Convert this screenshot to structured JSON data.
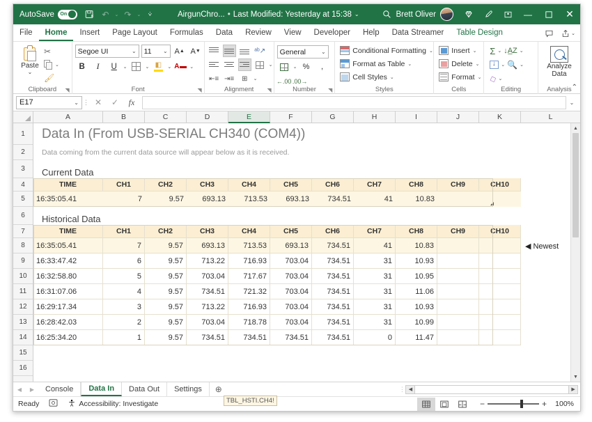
{
  "titlebar": {
    "autosave_label": "AutoSave",
    "autosave_state": "On",
    "doc_name": "AirgunChro...",
    "doc_separator": "•",
    "modified_text": "Last Modified: Yesterday at 15:38",
    "user_name": "Brett Oliver",
    "search_icon": "search-icon",
    "save_icon": "save-icon",
    "undo_icon": "undo-icon",
    "redo_icon": "redo-icon",
    "qat_more_icon": "customize-quick-access-toolbar-icon",
    "diamond_icon": "microsoft-rewards-icon",
    "pen_icon": "ink-pen-icon",
    "ribbon_display_icon": "ribbon-display-options-icon",
    "minimize_label": "—",
    "maximize_label": "▢",
    "close_label": "✕"
  },
  "ribbon_tabs": {
    "items": [
      {
        "label": "File",
        "state": "normal"
      },
      {
        "label": "Home",
        "state": "active"
      },
      {
        "label": "Insert",
        "state": "normal"
      },
      {
        "label": "Page Layout",
        "state": "normal"
      },
      {
        "label": "Formulas",
        "state": "normal"
      },
      {
        "label": "Data",
        "state": "normal"
      },
      {
        "label": "Review",
        "state": "normal"
      },
      {
        "label": "View",
        "state": "normal"
      },
      {
        "label": "Developer",
        "state": "normal"
      },
      {
        "label": "Help",
        "state": "normal"
      },
      {
        "label": "Data Streamer",
        "state": "normal"
      },
      {
        "label": "Table Design",
        "state": "contextual"
      }
    ],
    "comments_icon": "comments-icon",
    "share_icon": "share-icon",
    "share_caret": "⌄"
  },
  "ribbon": {
    "clipboard": {
      "group_label": "Clipboard",
      "paste_label": "Paste",
      "paste_caret": "⌄",
      "cut_label": "Cut",
      "copy_label": "Copy",
      "format_painter_label": "Format Painter",
      "dialog_launcher": "◥"
    },
    "font": {
      "group_label": "Font",
      "font_name": "Segoe UI",
      "font_size": "11",
      "grow_font": "A",
      "shrink_font": "A",
      "bold": "B",
      "italic": "I",
      "underline": "U",
      "borders_label": "Borders",
      "fill_color_label": "Fill Color",
      "font_color_label": "Font Color",
      "dialog_launcher": "◥"
    },
    "alignment": {
      "group_label": "Alignment",
      "top_align": "Top Align",
      "middle_align": "Middle Align",
      "bottom_align": "Bottom Align",
      "orientation": "Orientation",
      "align_left": "Align Left",
      "center": "Center",
      "align_right": "Align Right",
      "wrap_text": "Wrap Text",
      "decrease_indent": "Decrease Indent",
      "increase_indent": "Increase Indent",
      "merge_center": "Merge & Center",
      "dialog_launcher": "◥"
    },
    "number": {
      "group_label": "Number",
      "format_value": "General",
      "accounting": "Accounting Number Format",
      "percent": "%",
      "comma": ",",
      "increase_decimal": "Increase Decimal",
      "decrease_decimal": "Decrease Decimal",
      "dialog_launcher": "◥"
    },
    "styles": {
      "group_label": "Styles",
      "conditional_formatting": "Conditional Formatting",
      "format_as_table": "Format as Table",
      "cell_styles": "Cell Styles",
      "caret": "⌄"
    },
    "cells": {
      "group_label": "Cells",
      "insert": "Insert",
      "delete": "Delete",
      "format": "Format",
      "caret": "⌄"
    },
    "editing": {
      "group_label": "Editing",
      "autosum": "Σ",
      "sort_filter": "Sort & Filter",
      "fill": "Fill",
      "find_select": "Find & Select",
      "clear": "Clear",
      "caret": "⌄"
    },
    "analysis": {
      "group_label": "Analysis",
      "analyze_line1": "Analyze",
      "analyze_line2": "Data"
    },
    "collapse_icon": "collapse-ribbon-icon"
  },
  "formula_bar": {
    "name_box_value": "E17",
    "name_box_caret": "⌄",
    "insert_function_label": "fx",
    "cancel_label": "✕",
    "enter_label": "✓",
    "formula_value": "",
    "expand_caret": "⌄"
  },
  "grid": {
    "columns": [
      "A",
      "B",
      "C",
      "D",
      "E",
      "F",
      "G",
      "H",
      "I",
      "J",
      "K",
      "L"
    ],
    "selected_column": "E",
    "rows": [
      "1",
      "2",
      "3",
      "4",
      "5",
      "6",
      "7",
      "8",
      "9",
      "10",
      "11",
      "12",
      "13",
      "14",
      "15",
      "16"
    ],
    "title": "Data In (From USB-SERIAL CH340 (COM4))",
    "subtitle": "Data coming from the current data source will appear below as it is received.",
    "current_data_heading": "Current Data",
    "historical_data_heading": "Historical Data",
    "newest_label": "Newest",
    "newest_arrow": "◀"
  },
  "chart_data": {
    "type": "table",
    "title": "Data In (From USB-SERIAL CH340 (COM4))",
    "tables": [
      {
        "name": "Current Data",
        "columns": [
          "TIME",
          "CH1",
          "CH2",
          "CH3",
          "CH4",
          "CH5",
          "CH6",
          "CH7",
          "CH8",
          "CH9",
          "CH10"
        ],
        "rows": [
          [
            "16:35:05.41",
            "7",
            "9.57",
            "693.13",
            "713.53",
            "693.13",
            "734.51",
            "41",
            "10.83",
            "",
            ""
          ]
        ]
      },
      {
        "name": "Historical Data",
        "columns": [
          "TIME",
          "CH1",
          "CH2",
          "CH3",
          "CH4",
          "CH5",
          "CH6",
          "CH7",
          "CH8",
          "CH9",
          "CH10"
        ],
        "rows": [
          [
            "16:35:05.41",
            "7",
            "9.57",
            "693.13",
            "713.53",
            "693.13",
            "734.51",
            "41",
            "10.83",
            "",
            ""
          ],
          [
            "16:33:47.42",
            "6",
            "9.57",
            "713.22",
            "716.93",
            "703.04",
            "734.51",
            "31",
            "10.93",
            "",
            ""
          ],
          [
            "16:32:58.80",
            "5",
            "9.57",
            "703.04",
            "717.67",
            "703.04",
            "734.51",
            "31",
            "10.95",
            "",
            ""
          ],
          [
            "16:31:07.06",
            "4",
            "9.57",
            "734.51",
            "721.32",
            "703.04",
            "734.51",
            "31",
            "11.06",
            "",
            ""
          ],
          [
            "16:29:17.34",
            "3",
            "9.57",
            "713.22",
            "716.93",
            "703.04",
            "734.51",
            "31",
            "10.93",
            "",
            ""
          ],
          [
            "16:28:42.03",
            "2",
            "9.57",
            "703.04",
            "718.78",
            "703.04",
            "734.51",
            "31",
            "10.99",
            "",
            ""
          ],
          [
            "16:25:34.20",
            "1",
            "9.57",
            "734.51",
            "734.51",
            "734.51",
            "734.51",
            "0",
            "11.47",
            "",
            ""
          ]
        ]
      }
    ]
  },
  "sheet_tabs": {
    "prev_icon": "◀",
    "next_icon": "▶",
    "items": [
      {
        "label": "Console",
        "active": false
      },
      {
        "label": "Data In",
        "active": true
      },
      {
        "label": "Data Out",
        "active": false
      },
      {
        "label": "Settings",
        "active": false
      }
    ],
    "add_sheet_icon": "⊕"
  },
  "status_bar": {
    "ready_label": "Ready",
    "recording_icon": "macro-record-icon",
    "accessibility_label": "Accessibility: Investigate",
    "accessibility_icon": "accessibility-icon",
    "normal_view_icon": "normal-view-icon",
    "page_layout_icon": "page-layout-view-icon",
    "page_break_icon": "page-break-preview-icon",
    "zoom_out": "−",
    "zoom_in": "+",
    "zoom_level": "100%",
    "tooltip_chip": "TBL_HSTI.CH4!"
  }
}
